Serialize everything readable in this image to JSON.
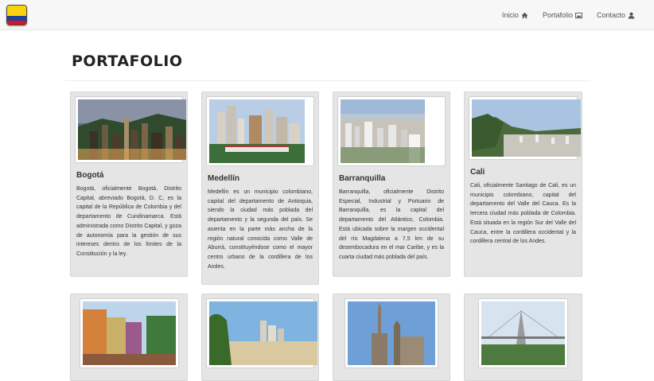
{
  "nav": {
    "links": [
      {
        "label": "Inicio",
        "icon": "home-icon"
      },
      {
        "label": "Portafolio",
        "icon": "picture-icon"
      },
      {
        "label": "Contacto",
        "icon": "user-icon"
      }
    ]
  },
  "page": {
    "title": "PORTAFOLIO"
  },
  "colors": {
    "flag_yellow": "#f8d20a",
    "flag_blue": "#1f3f9c",
    "flag_red": "#d3161e",
    "card_bg": "#e5e5e5"
  },
  "cards": [
    {
      "title": "Bogotá",
      "text": "Bogotá, oficialmente Bogotá, Distrito Capital, abreviado Bogotá, D. C, es la capital de la República de Colombia y del departamento de Cundinamarca. Está administrada como Distrito Capital, y goza de autonomía para la gestión de sus intereses dentro de los límites de la Constitución y la ley."
    },
    {
      "title": "Medellín",
      "text": "Medellín es un municipio colombiano, capital del departamento de Antioquia, siendo la ciudad más poblada del departamento y la segunda del país. Se asienta en la parte más ancha de la región natural conocida como Valle de Aburrá, constituyéndose como el mayor centro urbano de la cordillera de los Andes."
    },
    {
      "title": "Barranquilla",
      "text": "Barranquilla, oficialmente Distrito Especial, Industrial y Portuario de Barranquilla, es la capital del departamento del Atlántico, Colombia. Está ubicada sobre la margen occidental del río Magdalena a 7,5 km de su desembocadura en el mar Caribe, y es la cuarta ciudad más poblada del país."
    },
    {
      "title": "Cali",
      "text": "Cali, oficialmente Santiago de Cali, es un municipio colombiano, capital del departamento del Valle del Cauca. Es la tercera ciudad más poblada de Colombia. Está situada en la región Sur del Valle del Cauca, entre la cordillera occidental y la cordillera central de los Andes."
    }
  ]
}
